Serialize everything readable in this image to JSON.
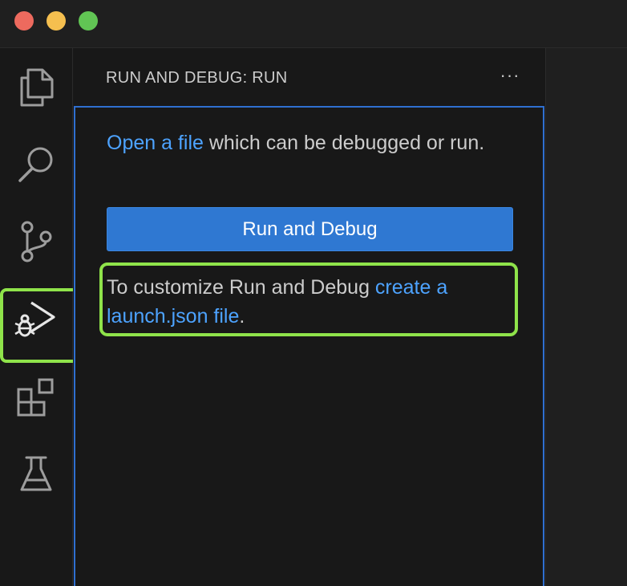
{
  "window": {
    "traffic_lights": {
      "close_color": "#ed6a5e",
      "minimize_color": "#f5bf4f",
      "maximize_color": "#61c554"
    }
  },
  "activity_bar": {
    "items": [
      {
        "icon": "files-icon",
        "label": "Explorer"
      },
      {
        "icon": "search-icon",
        "label": "Search"
      },
      {
        "icon": "source-control-icon",
        "label": "Source Control"
      },
      {
        "icon": "run-debug-icon",
        "label": "Run and Debug",
        "active": true
      },
      {
        "icon": "extensions-icon",
        "label": "Extensions"
      },
      {
        "icon": "testing-icon",
        "label": "Testing"
      }
    ]
  },
  "sidebar": {
    "title": "RUN AND DEBUG: RUN",
    "more_label": "···",
    "intro": {
      "link_text": "Open a file",
      "rest_text": " which can be debugged or run."
    },
    "run_button_label": "Run and Debug",
    "customize": {
      "text": "To customize Run and Debug ",
      "link_text": "create a launch.json file",
      "end_text": "."
    }
  },
  "colors": {
    "accent": "#2f78d2",
    "link": "#4da3ff",
    "highlight": "#8fe34a",
    "focus_border": "#2f6fd0"
  }
}
